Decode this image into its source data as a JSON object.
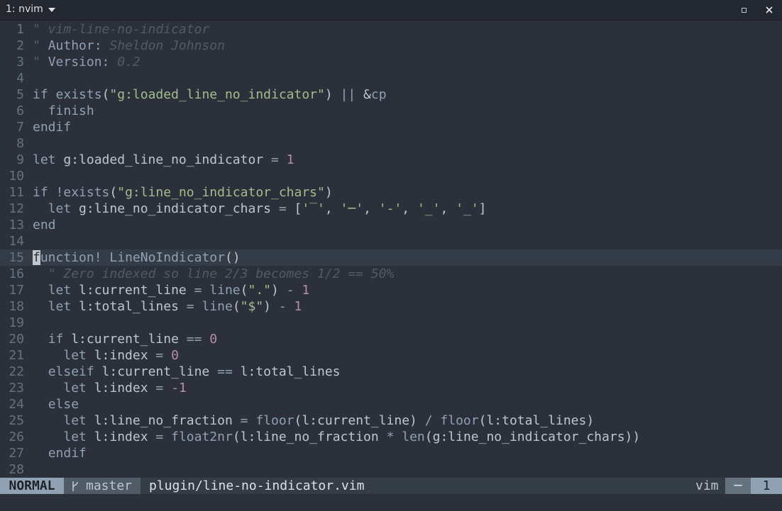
{
  "window": {
    "tab_title": "1: nvim",
    "icons": [
      "chevron-down-icon",
      "maximize-icon",
      "close-icon"
    ]
  },
  "editor": {
    "file_path": "plugin/line-no-indicator.vim",
    "cursor_line": 15,
    "lines": [
      {
        "n": "1",
        "tokens": [
          [
            "com",
            "\" vim-line-no-indicator"
          ]
        ]
      },
      {
        "n": "2",
        "tokens": [
          [
            "com",
            "\" "
          ],
          [
            "kw",
            "Author:"
          ],
          [
            "com",
            " Sheldon Johnson"
          ]
        ]
      },
      {
        "n": "3",
        "tokens": [
          [
            "com",
            "\" "
          ],
          [
            "kw",
            "Version:"
          ],
          [
            "com",
            " 0.2"
          ]
        ]
      },
      {
        "n": "4",
        "tokens": []
      },
      {
        "n": "5",
        "tokens": [
          [
            "kw",
            "if"
          ],
          [
            "id",
            " "
          ],
          [
            "fn",
            "exists"
          ],
          [
            "id",
            "("
          ],
          [
            "str",
            "\"g:loaded_line_no_indicator\""
          ],
          [
            "id",
            ") "
          ],
          [
            "op",
            "||"
          ],
          [
            "id",
            " &"
          ],
          [
            "kw",
            "cp"
          ]
        ]
      },
      {
        "n": "6",
        "tokens": [
          [
            "id",
            "  "
          ],
          [
            "kw",
            "finish"
          ]
        ]
      },
      {
        "n": "7",
        "tokens": [
          [
            "kw",
            "endif"
          ]
        ]
      },
      {
        "n": "8",
        "tokens": []
      },
      {
        "n": "9",
        "tokens": [
          [
            "kw",
            "let"
          ],
          [
            "id",
            " g:loaded_line_no_indicator "
          ],
          [
            "op",
            "="
          ],
          [
            "id",
            " "
          ],
          [
            "num",
            "1"
          ]
        ]
      },
      {
        "n": "10",
        "tokens": []
      },
      {
        "n": "11",
        "tokens": [
          [
            "kw",
            "if"
          ],
          [
            "id",
            " "
          ],
          [
            "op",
            "!"
          ],
          [
            "fn",
            "exists"
          ],
          [
            "id",
            "("
          ],
          [
            "str",
            "\"g:line_no_indicator_chars\""
          ],
          [
            "id",
            ")"
          ]
        ]
      },
      {
        "n": "12",
        "tokens": [
          [
            "id",
            "  "
          ],
          [
            "kw",
            "let"
          ],
          [
            "id",
            " g:line_no_indicator_chars "
          ],
          [
            "op",
            "="
          ],
          [
            "id",
            " ["
          ],
          [
            "str",
            "'‾'"
          ],
          [
            "id",
            ", "
          ],
          [
            "str",
            "'─'"
          ],
          [
            "id",
            ", "
          ],
          [
            "str",
            "'-'"
          ],
          [
            "id",
            ", "
          ],
          [
            "str",
            "'_'"
          ],
          [
            "id",
            ", "
          ],
          [
            "str",
            "'_'"
          ],
          [
            "id",
            "]"
          ]
        ]
      },
      {
        "n": "13",
        "tokens": [
          [
            "kw",
            "end"
          ]
        ]
      },
      {
        "n": "14",
        "tokens": []
      },
      {
        "n": "15",
        "tokens": [
          [
            "cur",
            "f"
          ],
          [
            "kw",
            "unction"
          ],
          [
            "op",
            "!"
          ],
          [
            "id",
            " "
          ],
          [
            "fn",
            "LineNoIndicator"
          ],
          [
            "id",
            "()"
          ]
        ]
      },
      {
        "n": "16",
        "tokens": [
          [
            "id",
            "  "
          ],
          [
            "com",
            "\" Zero indexed so line 2/3 becomes 1/2 == 50%"
          ]
        ]
      },
      {
        "n": "17",
        "tokens": [
          [
            "id",
            "  "
          ],
          [
            "kw",
            "let"
          ],
          [
            "id",
            " l:current_line "
          ],
          [
            "op",
            "="
          ],
          [
            "id",
            " "
          ],
          [
            "fn",
            "line"
          ],
          [
            "id",
            "("
          ],
          [
            "str",
            "\".\""
          ],
          [
            "id",
            ") "
          ],
          [
            "op",
            "-"
          ],
          [
            "id",
            " "
          ],
          [
            "num",
            "1"
          ]
        ]
      },
      {
        "n": "18",
        "tokens": [
          [
            "id",
            "  "
          ],
          [
            "kw",
            "let"
          ],
          [
            "id",
            " l:total_lines "
          ],
          [
            "op",
            "="
          ],
          [
            "id",
            " "
          ],
          [
            "fn",
            "line"
          ],
          [
            "id",
            "("
          ],
          [
            "str",
            "\"$\""
          ],
          [
            "id",
            ") "
          ],
          [
            "op",
            "-"
          ],
          [
            "id",
            " "
          ],
          [
            "num",
            "1"
          ]
        ]
      },
      {
        "n": "19",
        "tokens": []
      },
      {
        "n": "20",
        "tokens": [
          [
            "id",
            "  "
          ],
          [
            "kw",
            "if"
          ],
          [
            "id",
            " l:current_line "
          ],
          [
            "op",
            "=="
          ],
          [
            "id",
            " "
          ],
          [
            "num",
            "0"
          ]
        ]
      },
      {
        "n": "21",
        "tokens": [
          [
            "id",
            "    "
          ],
          [
            "kw",
            "let"
          ],
          [
            "id",
            " l:index "
          ],
          [
            "op",
            "="
          ],
          [
            "id",
            " "
          ],
          [
            "num",
            "0"
          ]
        ]
      },
      {
        "n": "22",
        "tokens": [
          [
            "id",
            "  "
          ],
          [
            "kw",
            "elseif"
          ],
          [
            "id",
            " l:current_line "
          ],
          [
            "op",
            "=="
          ],
          [
            "id",
            " l:total_lines"
          ]
        ]
      },
      {
        "n": "23",
        "tokens": [
          [
            "id",
            "    "
          ],
          [
            "kw",
            "let"
          ],
          [
            "id",
            " l:index "
          ],
          [
            "op",
            "="
          ],
          [
            "id",
            " "
          ],
          [
            "num",
            "-1"
          ]
        ]
      },
      {
        "n": "24",
        "tokens": [
          [
            "id",
            "  "
          ],
          [
            "kw",
            "else"
          ]
        ]
      },
      {
        "n": "25",
        "tokens": [
          [
            "id",
            "    "
          ],
          [
            "kw",
            "let"
          ],
          [
            "id",
            " l:line_no_fraction "
          ],
          [
            "op",
            "="
          ],
          [
            "id",
            " "
          ],
          [
            "fn",
            "floor"
          ],
          [
            "id",
            "(l:current_line) "
          ],
          [
            "op",
            "/"
          ],
          [
            "id",
            " "
          ],
          [
            "fn",
            "floor"
          ],
          [
            "id",
            "(l:total_lines)"
          ]
        ]
      },
      {
        "n": "26",
        "tokens": [
          [
            "id",
            "    "
          ],
          [
            "kw",
            "let"
          ],
          [
            "id",
            " l:index "
          ],
          [
            "op",
            "="
          ],
          [
            "id",
            " "
          ],
          [
            "fn",
            "float2nr"
          ],
          [
            "id",
            "(l:line_no_fraction "
          ],
          [
            "op",
            "*"
          ],
          [
            "id",
            " "
          ],
          [
            "fn",
            "len"
          ],
          [
            "id",
            "(g:line_no_indicator_chars))"
          ]
        ]
      },
      {
        "n": "27",
        "tokens": [
          [
            "id",
            "  "
          ],
          [
            "kw",
            "endif"
          ]
        ]
      },
      {
        "n": "28",
        "tokens": []
      }
    ]
  },
  "statusline": {
    "mode": "NORMAL",
    "branch": "master",
    "filename": "plugin/line-no-indicator.vim",
    "filetype": "vim",
    "indicator": "─",
    "line_number": "1"
  },
  "colors": {
    "background": "#2b303b",
    "comment": "#4f5b66",
    "keyword": "#8fa1b3",
    "string": "#a3be8c",
    "number": "#b48ead",
    "foreground": "#c0c5ce"
  }
}
